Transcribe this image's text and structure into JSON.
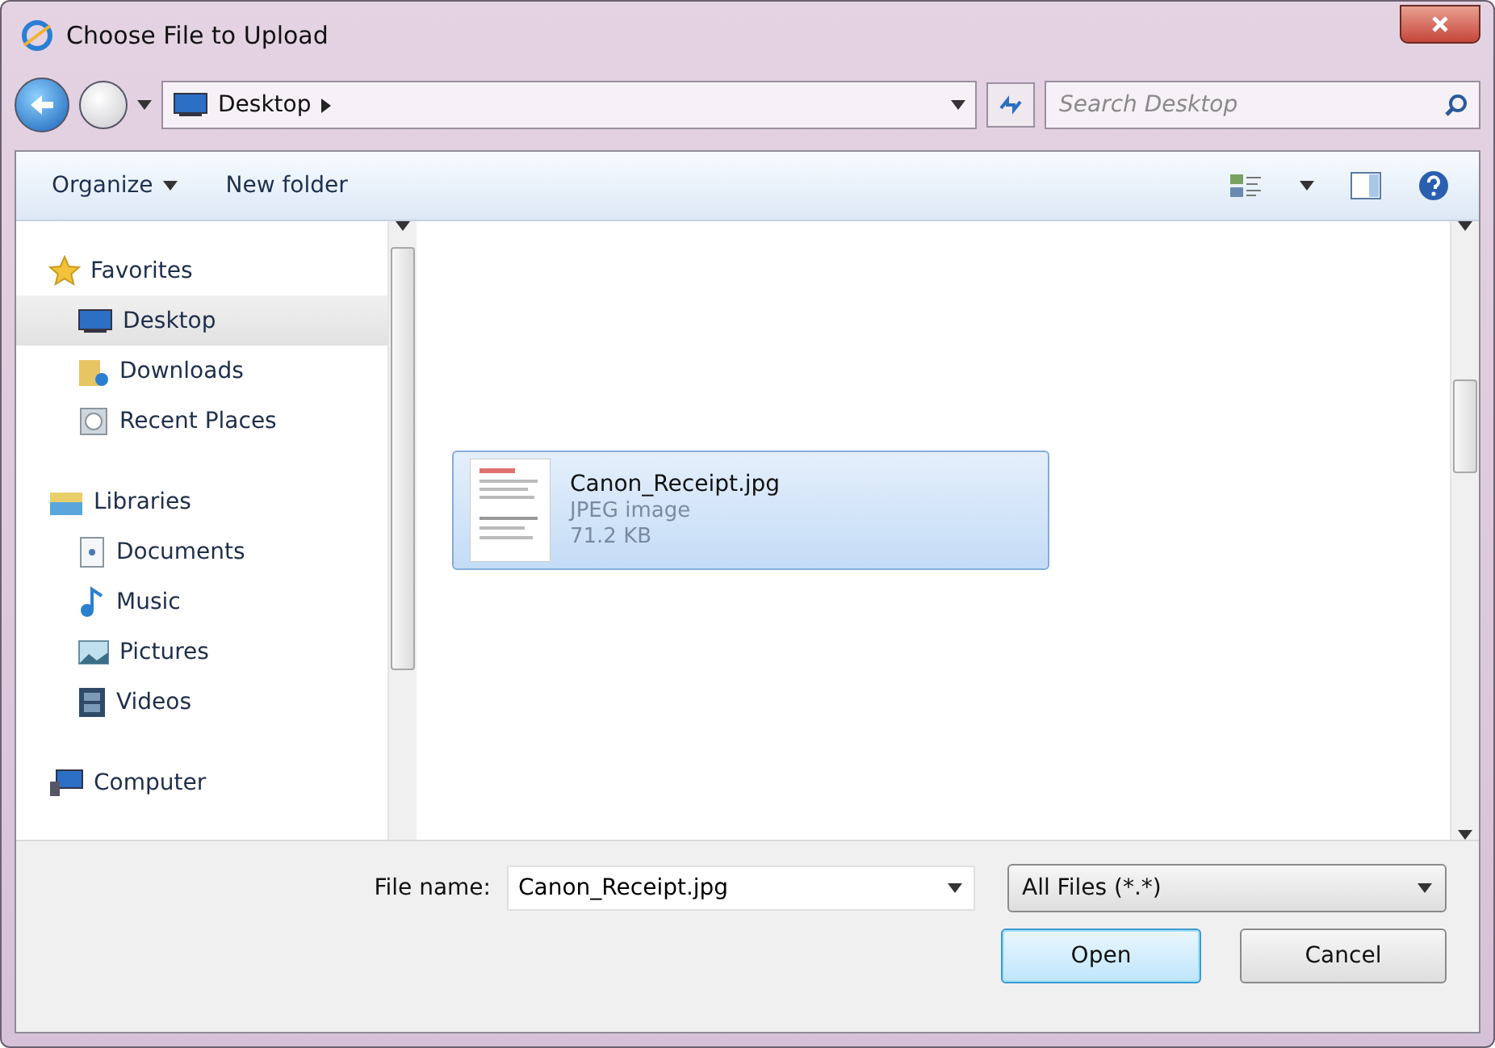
{
  "window": {
    "title": "Choose File to Upload"
  },
  "address": {
    "crumbs": [
      "Desktop"
    ]
  },
  "search": {
    "placeholder": "Search Desktop"
  },
  "toolbar": {
    "buttons": [
      {
        "label": "Organize",
        "dropdown": true
      },
      {
        "label": "New folder",
        "dropdown": false
      }
    ]
  },
  "sidebar": {
    "groups": [
      {
        "label": "Favorites",
        "children": [
          {
            "label": "Desktop",
            "selected": true
          },
          {
            "label": "Downloads",
            "selected": false
          },
          {
            "label": "Recent Places",
            "selected": false
          }
        ]
      },
      {
        "label": "Libraries",
        "children": [
          {
            "label": "Documents",
            "selected": false
          },
          {
            "label": "Music",
            "selected": false
          },
          {
            "label": "Pictures",
            "selected": false
          },
          {
            "label": "Videos",
            "selected": false
          }
        ]
      },
      {
        "label": "Computer"
      }
    ]
  },
  "files": [
    {
      "name": "Canon_Receipt.jpg",
      "type": "JPEG image",
      "size": "71.2 KB",
      "selected": true
    }
  ],
  "footer": {
    "file_name_label": "File name:",
    "file_name": "Canon_Receipt.jpg",
    "filter": "All Files (*.*)",
    "buttons": [
      {
        "label": "Open",
        "default": true
      },
      {
        "label": "Cancel",
        "default": false
      }
    ]
  }
}
